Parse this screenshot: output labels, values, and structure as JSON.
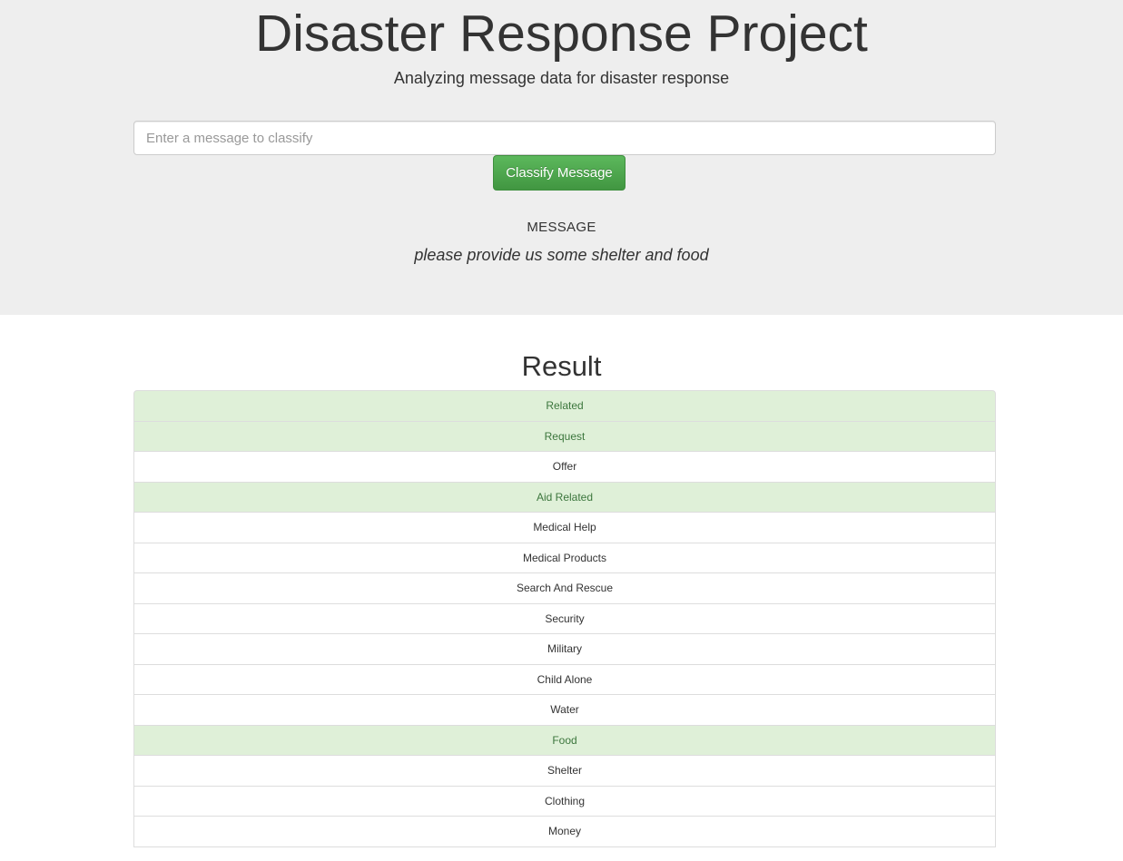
{
  "header": {
    "title": "Disaster Response Project",
    "subtitle": "Analyzing message data for disaster response"
  },
  "form": {
    "input_value": "",
    "input_placeholder": "Enter a message to classify",
    "button_label": "Classify Message",
    "button_color": "#5cb85c"
  },
  "message": {
    "label": "MESSAGE",
    "text": "please provide us some shelter and food"
  },
  "result": {
    "heading": "Result",
    "positive_color": "#dff0d8",
    "positive_text_color": "#3c763d",
    "items": [
      {
        "label": "Related",
        "positive": true
      },
      {
        "label": "Request",
        "positive": true
      },
      {
        "label": "Offer",
        "positive": false
      },
      {
        "label": "Aid Related",
        "positive": true
      },
      {
        "label": "Medical Help",
        "positive": false
      },
      {
        "label": "Medical Products",
        "positive": false
      },
      {
        "label": "Search And Rescue",
        "positive": false
      },
      {
        "label": "Security",
        "positive": false
      },
      {
        "label": "Military",
        "positive": false
      },
      {
        "label": "Child Alone",
        "positive": false
      },
      {
        "label": "Water",
        "positive": false
      },
      {
        "label": "Food",
        "positive": true
      },
      {
        "label": "Shelter",
        "positive": false
      },
      {
        "label": "Clothing",
        "positive": false
      },
      {
        "label": "Money",
        "positive": false
      }
    ]
  }
}
